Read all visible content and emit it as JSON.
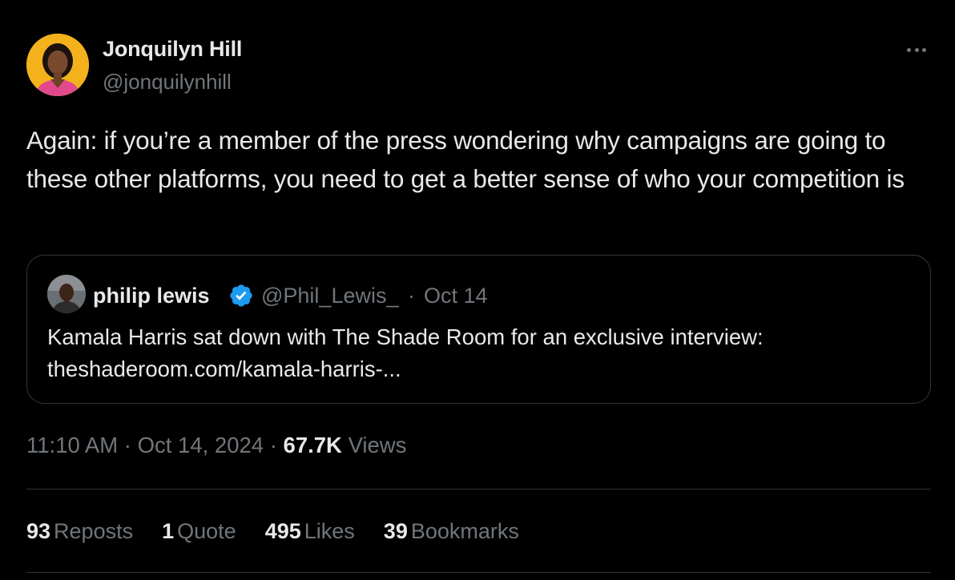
{
  "author": {
    "name": "Jonquilyn Hill",
    "handle": "@jonquilynhill"
  },
  "tweet_text": "Again: if you’re a member of the press wondering why campaigns are going to these other platforms, you need to get a better sense of who your competition is",
  "quoted_tweet": {
    "name": "philip lewis",
    "handle": "@Phil_Lewis_",
    "separator": "·",
    "date": "Oct 14",
    "text_line1": "Kamala Harris sat down with The Shade Room for an exclusive interview:",
    "text_line2": "theshaderoom.com/kamala-harris-..."
  },
  "meta": {
    "time": "11:10 AM",
    "separator": "·",
    "date": "Oct 14, 2024",
    "views_count": "67.7K",
    "views_label": "Views"
  },
  "stats": {
    "reposts_count": "93",
    "reposts_label": "Reposts",
    "quotes_count": "1",
    "quotes_label": "Quote",
    "likes_count": "495",
    "likes_label": "Likes",
    "bookmarks_count": "39",
    "bookmarks_label": "Bookmarks"
  },
  "colors": {
    "background": "#000000",
    "primary_text": "#e7e9ea",
    "secondary_text": "#71767b",
    "border": "#333639",
    "verified_blue": "#1d9bf0"
  },
  "icons": {
    "more": "more-horizontal-icon",
    "verified": "verified-badge-icon"
  }
}
